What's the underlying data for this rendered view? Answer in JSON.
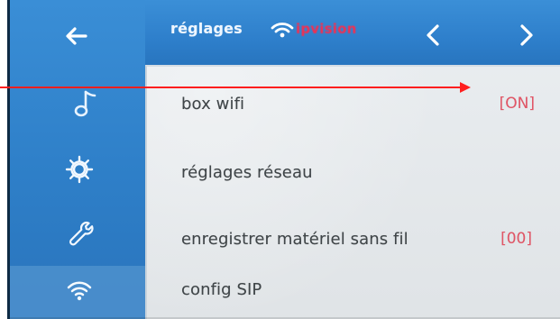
{
  "header": {
    "title": "réglages",
    "status_icon": "wifi-icon",
    "status_text": "ipvision",
    "back_icon": "back-arrow-icon",
    "prev_icon": "chevron-left-icon",
    "next_icon": "chevron-right-icon"
  },
  "sidebar": {
    "items": [
      {
        "icon": "music-note-icon"
      },
      {
        "icon": "gear-icon"
      },
      {
        "icon": "wrench-icon"
      },
      {
        "icon": "wifi-icon"
      }
    ]
  },
  "menu": {
    "items": [
      {
        "label": "box wifi",
        "value": "[ON]"
      },
      {
        "label": "réglages réseau",
        "value": ""
      },
      {
        "label": "enregistrer matériel sans fil",
        "value": "[00]"
      },
      {
        "label": "config SIP",
        "value": ""
      }
    ]
  },
  "colors": {
    "screen_blue": "#2b78c2",
    "panel_gray": "#e7ebee",
    "status_red": "#ff2a49",
    "value_red": "#e25566",
    "annotation_red": "#ff1e1e"
  }
}
